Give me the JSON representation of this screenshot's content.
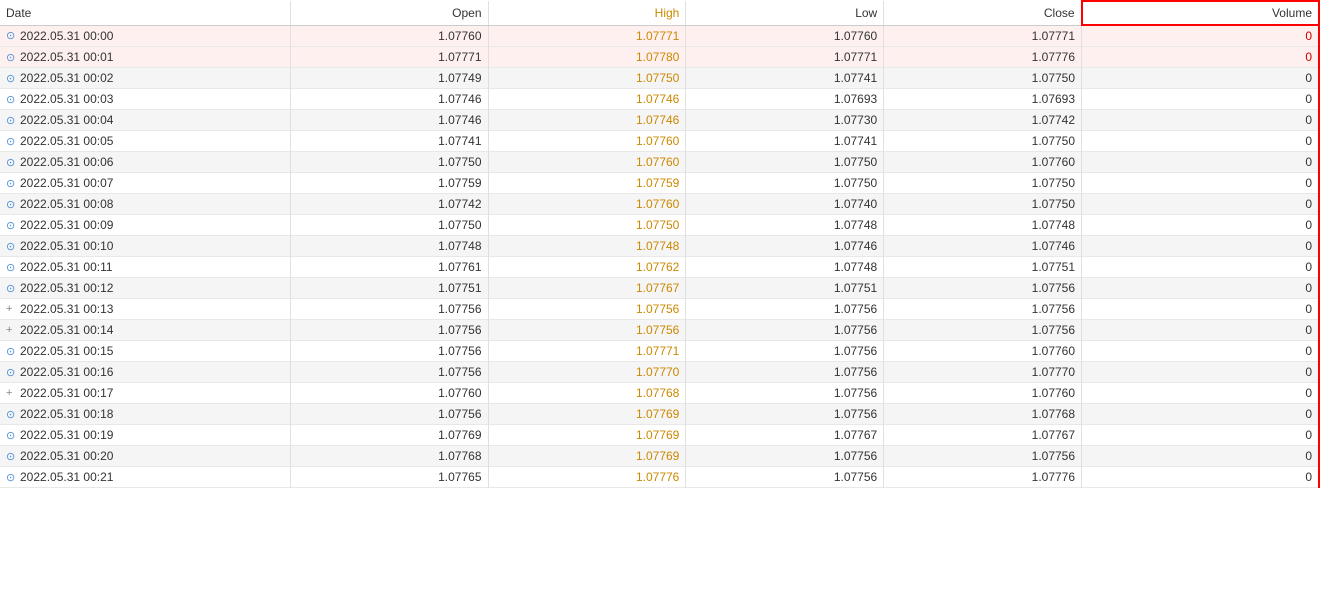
{
  "table": {
    "headers": {
      "date": "Date",
      "open": "Open",
      "high": "High",
      "low": "Low",
      "close": "Close",
      "volume": "Volume"
    },
    "rows": [
      {
        "icon": "doji",
        "date": "2022.05.31 00:00",
        "open": "1.07760",
        "high": "1.07771",
        "low": "1.07760",
        "close": "1.07771",
        "volume": "0"
      },
      {
        "icon": "doji",
        "date": "2022.05.31 00:01",
        "open": "1.07771",
        "high": "1.07780",
        "low": "1.07771",
        "close": "1.07776",
        "volume": "0"
      },
      {
        "icon": "doji",
        "date": "2022.05.31 00:02",
        "open": "1.07749",
        "high": "1.07750",
        "low": "1.07741",
        "close": "1.07750",
        "volume": "0"
      },
      {
        "icon": "doji",
        "date": "2022.05.31 00:03",
        "open": "1.07746",
        "high": "1.07746",
        "low": "1.07693",
        "close": "1.07693",
        "volume": "0"
      },
      {
        "icon": "doji",
        "date": "2022.05.31 00:04",
        "open": "1.07746",
        "high": "1.07746",
        "low": "1.07730",
        "close": "1.07742",
        "volume": "0"
      },
      {
        "icon": "doji",
        "date": "2022.05.31 00:05",
        "open": "1.07741",
        "high": "1.07760",
        "low": "1.07741",
        "close": "1.07750",
        "volume": "0"
      },
      {
        "icon": "doji",
        "date": "2022.05.31 00:06",
        "open": "1.07750",
        "high": "1.07760",
        "low": "1.07750",
        "close": "1.07760",
        "volume": "0"
      },
      {
        "icon": "doji",
        "date": "2022.05.31 00:07",
        "open": "1.07759",
        "high": "1.07759",
        "low": "1.07750",
        "close": "1.07750",
        "volume": "0"
      },
      {
        "icon": "doji",
        "date": "2022.05.31 00:08",
        "open": "1.07742",
        "high": "1.07760",
        "low": "1.07740",
        "close": "1.07750",
        "volume": "0"
      },
      {
        "icon": "doji",
        "date": "2022.05.31 00:09",
        "open": "1.07750",
        "high": "1.07750",
        "low": "1.07748",
        "close": "1.07748",
        "volume": "0"
      },
      {
        "icon": "doji",
        "date": "2022.05.31 00:10",
        "open": "1.07748",
        "high": "1.07748",
        "low": "1.07746",
        "close": "1.07746",
        "volume": "0"
      },
      {
        "icon": "doji",
        "date": "2022.05.31 00:11",
        "open": "1.07761",
        "high": "1.07762",
        "low": "1.07748",
        "close": "1.07751",
        "volume": "0"
      },
      {
        "icon": "doji",
        "date": "2022.05.31 00:12",
        "open": "1.07751",
        "high": "1.07767",
        "low": "1.07751",
        "close": "1.07756",
        "volume": "0"
      },
      {
        "icon": "plus",
        "date": "2022.05.31 00:13",
        "open": "1.07756",
        "high": "1.07756",
        "low": "1.07756",
        "close": "1.07756",
        "volume": "0"
      },
      {
        "icon": "plus",
        "date": "2022.05.31 00:14",
        "open": "1.07756",
        "high": "1.07756",
        "low": "1.07756",
        "close": "1.07756",
        "volume": "0"
      },
      {
        "icon": "doji",
        "date": "2022.05.31 00:15",
        "open": "1.07756",
        "high": "1.07771",
        "low": "1.07756",
        "close": "1.07760",
        "volume": "0"
      },
      {
        "icon": "doji",
        "date": "2022.05.31 00:16",
        "open": "1.07756",
        "high": "1.07770",
        "low": "1.07756",
        "close": "1.07770",
        "volume": "0"
      },
      {
        "icon": "plus",
        "date": "2022.05.31 00:17",
        "open": "1.07760",
        "high": "1.07768",
        "low": "1.07756",
        "close": "1.07760",
        "volume": "0"
      },
      {
        "icon": "doji",
        "date": "2022.05.31 00:18",
        "open": "1.07756",
        "high": "1.07769",
        "low": "1.07756",
        "close": "1.07768",
        "volume": "0"
      },
      {
        "icon": "doji",
        "date": "2022.05.31 00:19",
        "open": "1.07769",
        "high": "1.07769",
        "low": "1.07767",
        "close": "1.07767",
        "volume": "0"
      },
      {
        "icon": "doji",
        "date": "2022.05.31 00:20",
        "open": "1.07768",
        "high": "1.07769",
        "low": "1.07756",
        "close": "1.07756",
        "volume": "0"
      },
      {
        "icon": "doji",
        "date": "2022.05.31 00:21",
        "open": "1.07765",
        "high": "1.07776",
        "low": "1.07756",
        "close": "1.07776",
        "volume": "0"
      }
    ]
  }
}
